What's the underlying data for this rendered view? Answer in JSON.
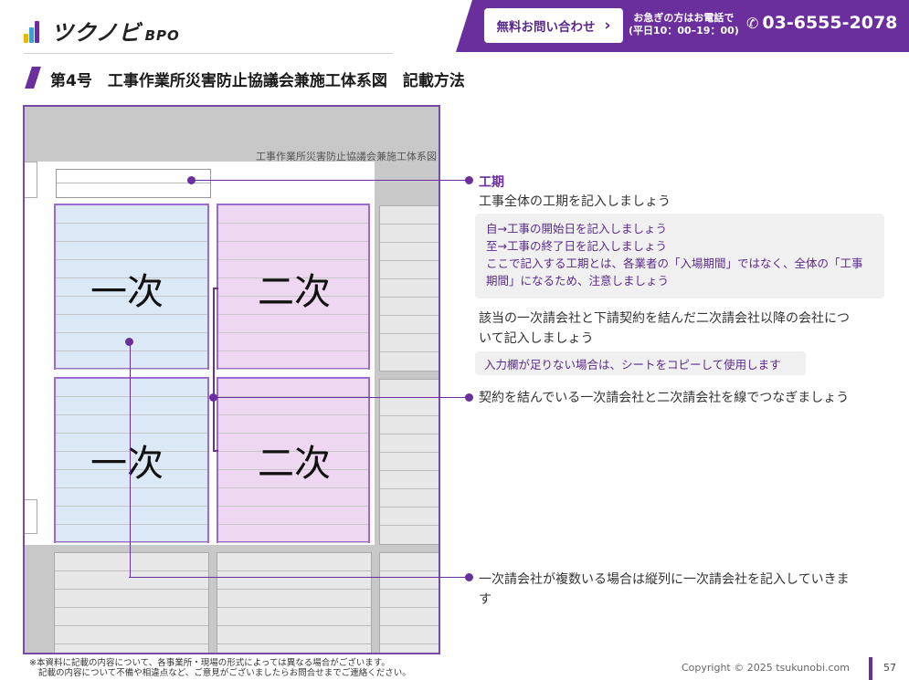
{
  "header": {
    "logo_text": "ツクノビ",
    "logo_suffix": "BPO",
    "contact_button": "無料お問い合わせ",
    "hours_line1": "お急ぎの方はお電話で",
    "hours_line2": "(平日10：00–19：00)",
    "phone": "03-6555-2078",
    "brand_color": "#6a2f9c"
  },
  "title": "第4号　工事作業所災害防止協議会兼施工体系図　記載方法",
  "form": {
    "caption": "工事作業所災害防止協議会兼施工体系図",
    "labels": [
      "一次",
      "二次",
      "一次",
      "二次"
    ]
  },
  "annotations": {
    "period_heading": "工期",
    "period_text": "工事全体の工期を記入しましょう",
    "period_notes": [
      "自→工事の開始日を記入しましょう",
      "至→工事の終了日を記入しましょう",
      "ここで記入する工期とは、各業者の「入場期間」ではなく、全体の「工事",
      "期間」になるため、注意しましょう"
    ],
    "subcontract_line1": "該当の一次請会社と下請契約を結んだ二次請会社以降の会社につ",
    "subcontract_line2": "いて記入しましょう",
    "subcontract_note": "入力欄が足りない場合は、シートをコピーして使用します",
    "connect_text": "契約を結んでいる一次請会社と二次請会社を線でつなぎましょう",
    "multiple_line1": "一次請会社が複数いる場合は縦列に一次請会社を記入していきま",
    "multiple_line2": "す"
  },
  "footer": {
    "note_line1": "※本資料に記載の内容について、各事業所・現場の形式によっては異なる場合がございます。",
    "note_line2": "記載の内容について不備や相違点など、ご意見がございましたらお問合せまでご連絡ください。",
    "copyright": "Copyright © 2025 tsukunobi.com",
    "page": "57"
  }
}
